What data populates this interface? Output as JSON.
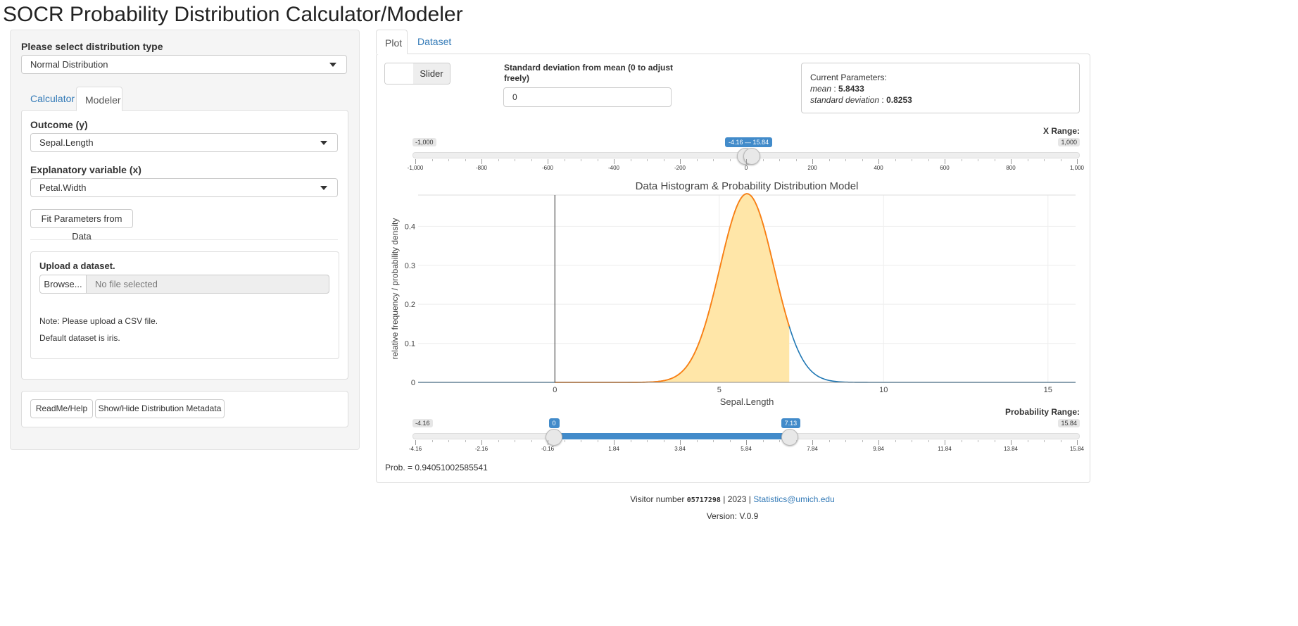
{
  "app": {
    "title": "SOCR Probability Distribution Calculator/Modeler"
  },
  "sidebar": {
    "dist_label": "Please select distribution type",
    "dist_value": "Normal Distribution",
    "tabs": [
      {
        "label": "Calculator"
      },
      {
        "label": "Modeler"
      }
    ],
    "outcome_label": "Outcome (y)",
    "outcome_value": "Sepal.Length",
    "explanatory_label": "Explanatory variable (x)",
    "explanatory_value": "Petal.Width",
    "fit_button": "Fit Parameters from Data",
    "upload": {
      "title": "Upload a dataset.",
      "browse": "Browse...",
      "placeholder": "No file selected",
      "note1": "Note: Please upload a CSV file.",
      "note2": "Default dataset is iris."
    },
    "readme_button": "ReadMe/Help",
    "metadata_button": "Show/Hide Distribution Metadata"
  },
  "main": {
    "tabs": [
      {
        "label": "Plot"
      },
      {
        "label": "Dataset"
      }
    ],
    "toggle_label": "Slider",
    "sd_label_line1": "Standard deviation from mean (0 to adjust",
    "sd_label_line2": "freely)",
    "sd_value": "0",
    "params": {
      "title": "Current Parameters:",
      "mean_label": "mean",
      "mean_value": "5.8433",
      "sd_label": "standard deviation",
      "sd_value": "0.8253"
    },
    "xrange": {
      "label": "X Range:",
      "min_label": "-1,000",
      "max_label": "1,000",
      "min": -1000,
      "max": 1000,
      "from": -4.16,
      "to": 15.84,
      "value_label": "-4.16 — 15.84",
      "ticks": [
        "-1,000",
        "-800",
        "-600",
        "-400",
        "-200",
        "0",
        "200",
        "400",
        "600",
        "800",
        "1,000"
      ]
    },
    "prob_range": {
      "label": "Probability Range:",
      "min_label": "-4.16",
      "max_label": "15.84",
      "min": -4.16,
      "max": 15.84,
      "from": 0,
      "to": 7.13,
      "from_label": "0",
      "to_label": "7.13",
      "ticks": [
        "-4.16",
        "-2.16",
        "-0.16",
        "1.84",
        "3.84",
        "5.84",
        "7.84",
        "9.84",
        "11.84",
        "13.84",
        "15.84"
      ]
    },
    "prob_text": "Prob. = 0.94051002585541"
  },
  "chart_data": {
    "type": "area",
    "title": "Data Histogram & Probability Distribution Model",
    "xlabel": "Sepal.Length",
    "ylabel": "relative frequency / probability density",
    "xlim": [
      -4.16,
      15.84
    ],
    "ylim": [
      0,
      0.48
    ],
    "xticks": [
      0,
      5,
      10,
      15
    ],
    "yticks": [
      0,
      0.1,
      0.2,
      0.3,
      0.4
    ],
    "ytick_labels": [
      "0",
      "0.1",
      "0.2",
      "0.3",
      "0.4"
    ],
    "grid": true,
    "series": [
      {
        "kind": "normal_density",
        "mean": 5.8433,
        "sd": 0.8253,
        "color": "#1f77b4"
      },
      {
        "kind": "shaded_density",
        "from": 0,
        "to": 7.13,
        "mean": 5.8433,
        "sd": 0.8253,
        "line_color": "#ff7f0e",
        "fill_color": "#ffe6a8"
      }
    ],
    "vertical_line_x": 0
  },
  "footer": {
    "visitor_prefix": "Visitor number",
    "visitor_number": "05717298",
    "year_text": "| 2023 |",
    "email": "Statistics@umich.edu",
    "version": "Version: V.0.9"
  },
  "colors": {
    "accent": "#428bca",
    "link": "#337ab7",
    "curve": "#1f77b4",
    "shade_line": "#ff7f0e",
    "shade_fill": "#ffe6a8"
  }
}
